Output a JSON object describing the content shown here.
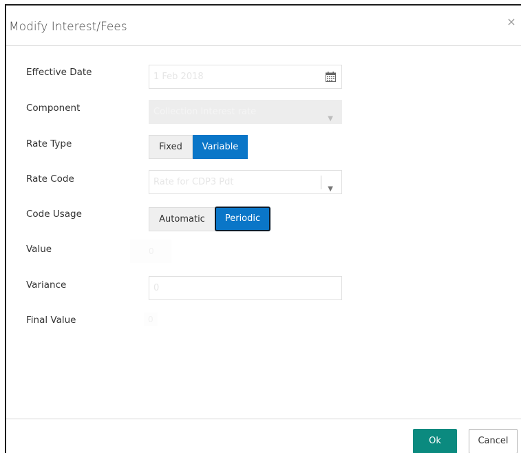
{
  "dialog": {
    "title": "Modify Interest/Fees",
    "close_glyph": "×"
  },
  "form": {
    "effective_date": {
      "label": "Effective Date",
      "value": "1 Feb 2018",
      "icon": "calendar-icon"
    },
    "component": {
      "label": "Component",
      "value": "Collection Interest rate",
      "icon": "chevron-down-icon"
    },
    "rate_type": {
      "label": "Rate Type",
      "options": [
        "Fixed",
        "Variable"
      ],
      "selected": "Variable"
    },
    "rate_code": {
      "label": "Rate Code",
      "value": "Rate for CDP3 Pdt",
      "icon": "chevron-down-icon"
    },
    "code_usage": {
      "label": "Code Usage",
      "options": [
        "Automatic",
        "Periodic"
      ],
      "selected": "Periodic"
    },
    "value": {
      "label": "Value",
      "value": "0"
    },
    "variance": {
      "label": "Variance",
      "value": "0"
    },
    "final_value": {
      "label": "Final Value",
      "value": "0"
    }
  },
  "footer": {
    "ok_label": "Ok",
    "cancel_label": "Cancel"
  },
  "colors": {
    "primary_blue": "#0a76c8",
    "ok_teal": "#0b8a7f"
  }
}
